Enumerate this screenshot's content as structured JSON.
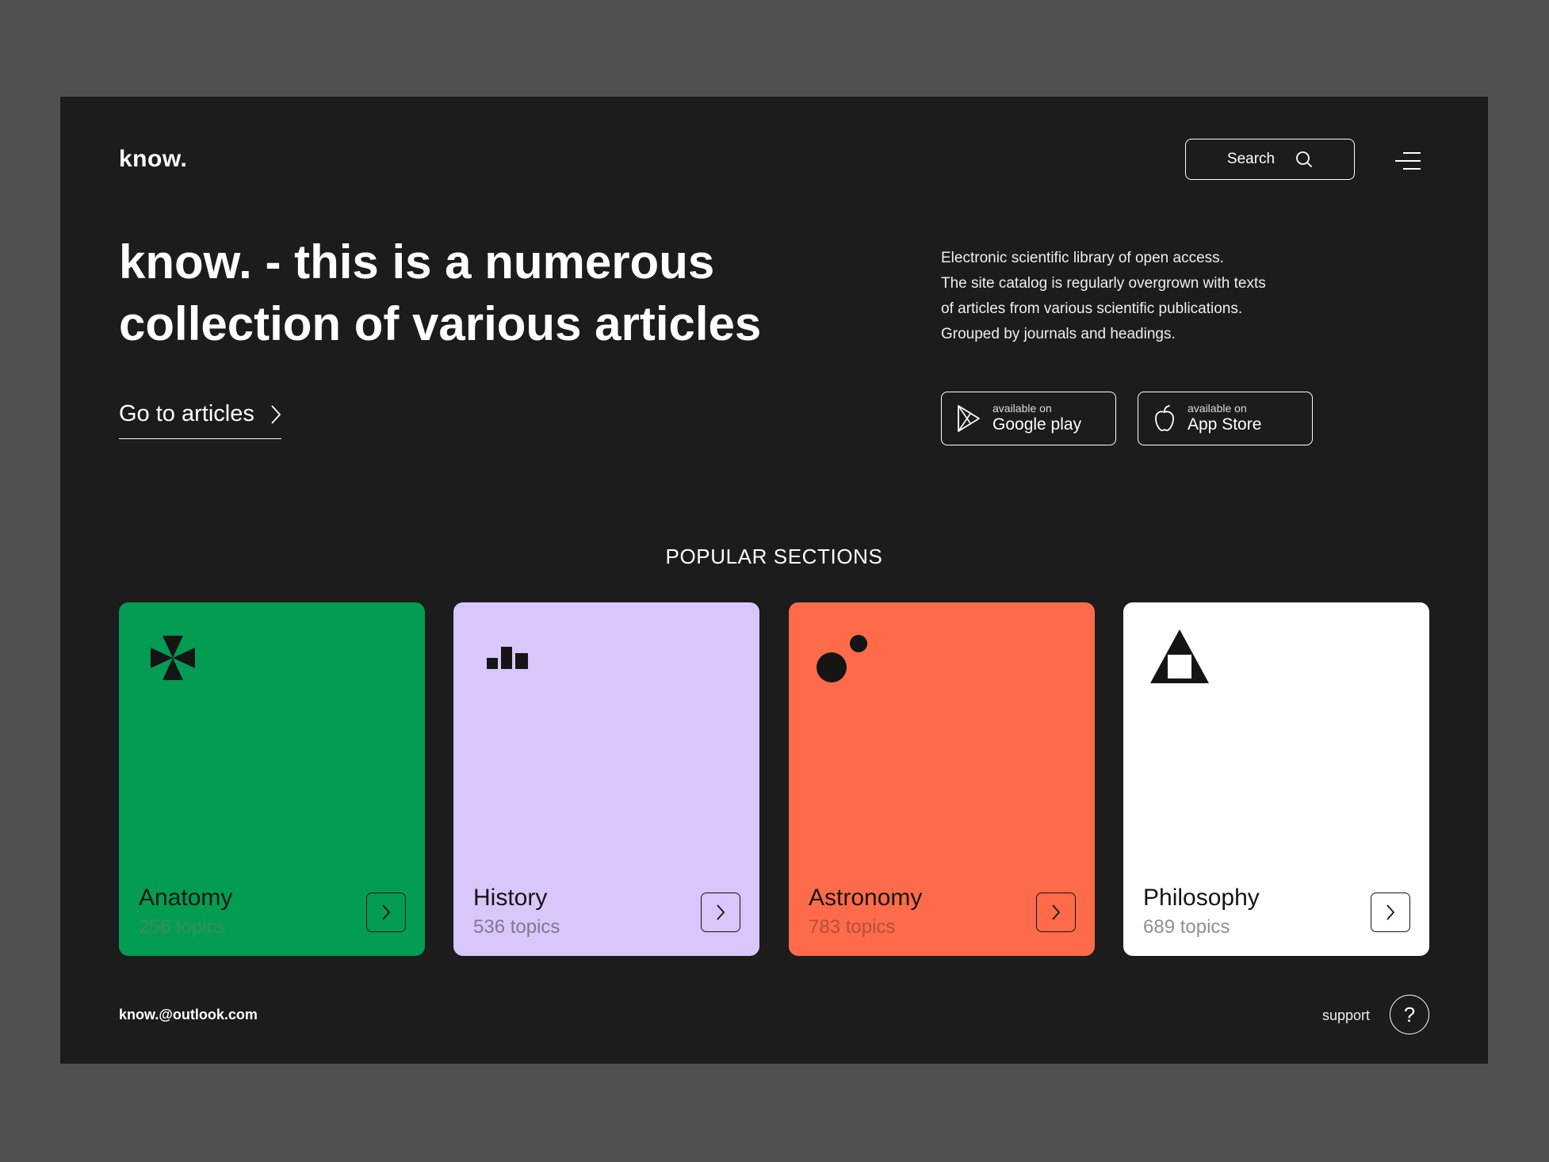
{
  "header": {
    "logo": "know.",
    "search_label": "Search"
  },
  "hero": {
    "title": "know. - this is a numerous collection of various articles",
    "cta_label": "Go to articles",
    "description": [
      "Electronic scientific library of open access.",
      "The site catalog is regularly overgrown with texts",
      "of articles from various scientific publications.",
      "Grouped by journals and headings."
    ]
  },
  "stores": [
    {
      "small": "available on",
      "name": "Google play",
      "icon": "google-play-icon"
    },
    {
      "small": "available on",
      "name": "App Store",
      "icon": "apple-icon"
    }
  ],
  "popular": {
    "title": "POPULAR SECTIONS",
    "cards": [
      {
        "name": "Anatomy",
        "count": "256 topics",
        "bg": "#029d52",
        "count_color": "#3d8a5c",
        "icon": "pinwheel-icon"
      },
      {
        "name": "History",
        "count": "536 topics",
        "bg": "#d9c6fb",
        "count_color": "#7f7890",
        "icon": "bar-chart-icon"
      },
      {
        "name": "Astronomy",
        "count": "783 topics",
        "bg": "#fe6b4a",
        "count_color": "#b2503a",
        "icon": "planets-icon"
      },
      {
        "name": "Philosophy",
        "count": "689 topics",
        "bg": "#ffffff",
        "count_color": "#8f8f8f",
        "icon": "triangle-square-icon"
      }
    ]
  },
  "footer": {
    "email": "know.@outlook.com",
    "support_label": "support",
    "help_glyph": "?"
  }
}
